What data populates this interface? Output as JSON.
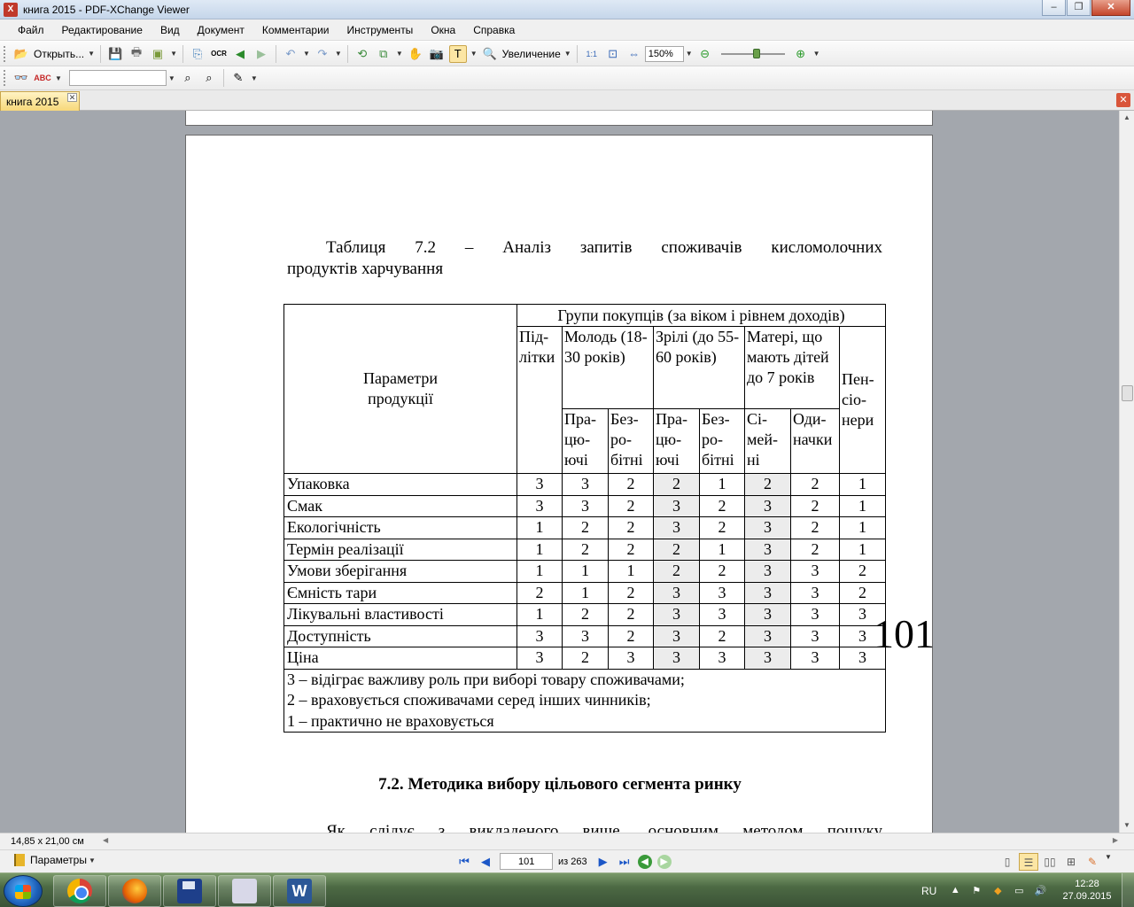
{
  "window": {
    "title": "книга 2015 - PDF-XChange Viewer",
    "icon": "pdf-xchange-icon"
  },
  "menu": [
    "Файл",
    "Редактирование",
    "Вид",
    "Документ",
    "Комментарии",
    "Инструменты",
    "Окна",
    "Справка"
  ],
  "toolbar": {
    "open_label": "Открыть...",
    "zoom_in_label": "Увеличение",
    "zoom_value": "150%",
    "search_value": ""
  },
  "tab": {
    "label": "книга 2015"
  },
  "page": {
    "caption_line1": "Таблиця 7.2 – Аналіз запитів споживачів кисломолочних",
    "caption_line2": "продуктів харчування",
    "header": {
      "params": "Параметри продукції",
      "groups": "Групи покупців (за віком і рівнем доходів)",
      "teens": "Під-літки",
      "youth": "Молодь (18-30 років)",
      "adults": "Зрілі (до 55-60 років)",
      "mothers": "Матері, що мають дітей до 7 років",
      "pensioners": "Пен-сіо-нери",
      "working1": "Пра-цю-ючі",
      "unemployed1": "Без-ро-бітні",
      "working2": "Пра-цю-ючі",
      "unemployed2": "Без-ро-бітні",
      "family": "Сі-мей-ні",
      "single": "Оди-начки"
    },
    "rows": [
      {
        "name": "Упаковка",
        "values": [
          "3",
          "3",
          "2",
          "2",
          "1",
          "2",
          "2",
          "1"
        ]
      },
      {
        "name": "Смак",
        "values": [
          "3",
          "3",
          "2",
          "3",
          "2",
          "3",
          "2",
          "1"
        ]
      },
      {
        "name": "Екологічність",
        "values": [
          "1",
          "2",
          "2",
          "3",
          "2",
          "3",
          "2",
          "1"
        ]
      },
      {
        "name": "Термін реалізації",
        "values": [
          "1",
          "2",
          "2",
          "2",
          "1",
          "3",
          "2",
          "1"
        ]
      },
      {
        "name": "Умови зберігання",
        "values": [
          "1",
          "1",
          "1",
          "2",
          "2",
          "3",
          "3",
          "2"
        ]
      },
      {
        "name": "Ємність тари",
        "values": [
          "2",
          "1",
          "2",
          "3",
          "3",
          "3",
          "3",
          "2"
        ]
      },
      {
        "name": "Лікувальні властивості",
        "values": [
          "1",
          "2",
          "2",
          "3",
          "3",
          "3",
          "3",
          "3"
        ]
      },
      {
        "name": "Доступність",
        "values": [
          "3",
          "3",
          "2",
          "3",
          "2",
          "3",
          "3",
          "3"
        ]
      },
      {
        "name": "Ціна",
        "values": [
          "3",
          "2",
          "3",
          "3",
          "3",
          "3",
          "3",
          "3"
        ]
      }
    ],
    "legend": [
      "3 – відіграє важливу роль при виборі товару споживачами;",
      "2 – враховується споживачами серед інших чинників;",
      "1 – практично не враховується"
    ],
    "page_number": "101",
    "section_title": "7.2. Методика вибору цільового сегмента ринку",
    "body_start": "Як слідує з викладеного вище, основним методом пошуку"
  },
  "status": {
    "page_size": "14,85 x 21,00 см",
    "params_label": "Параметры"
  },
  "nav": {
    "current_page": "101",
    "of_pages": "из 263"
  },
  "taskbar": {
    "apps": [
      "windows-start-icon",
      "chrome-icon",
      "firefox-icon",
      "save-drive-icon",
      "pdf-xchange-icon",
      "word-icon"
    ],
    "lang": "RU",
    "time": "12:28",
    "date": "27.09.2015"
  }
}
